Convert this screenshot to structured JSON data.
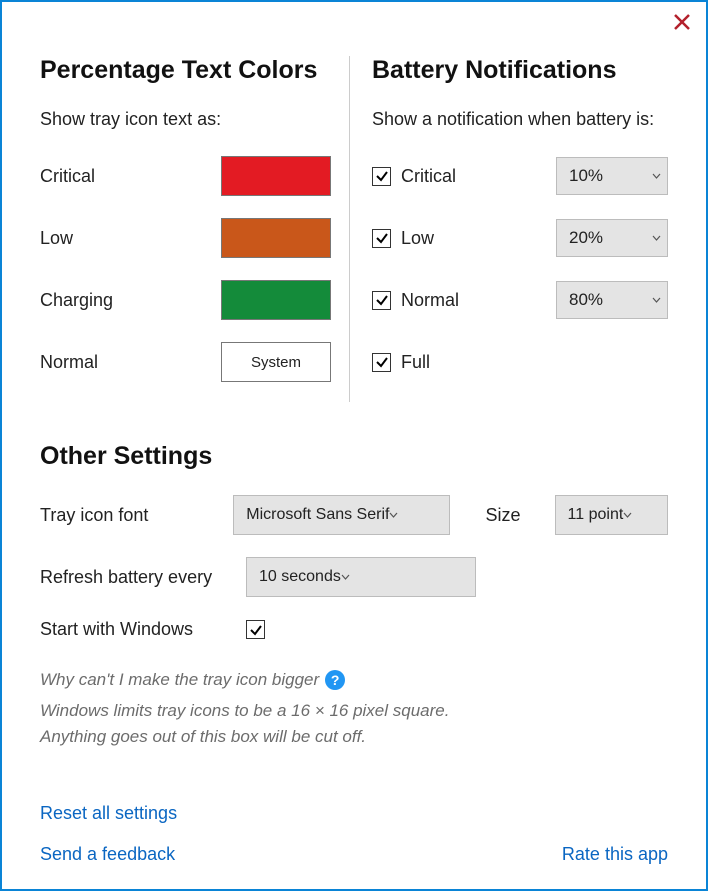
{
  "colors_section": {
    "title": "Percentage Text Colors",
    "subtitle": "Show tray icon text as:",
    "rows": {
      "critical": {
        "label": "Critical",
        "color": "#e31b23"
      },
      "low": {
        "label": "Low",
        "color": "#c9571a"
      },
      "charging": {
        "label": "Charging",
        "color": "#148b3a"
      },
      "normal": {
        "label": "Normal",
        "button_text": "System"
      }
    }
  },
  "notifications_section": {
    "title": "Battery Notifications",
    "subtitle": "Show a notification when battery is:",
    "critical": {
      "label": "Critical",
      "checked": true,
      "value": "10%"
    },
    "low": {
      "label": "Low",
      "checked": true,
      "value": "20%"
    },
    "normal": {
      "label": "Normal",
      "checked": true,
      "value": "80%"
    },
    "full": {
      "label": "Full",
      "checked": true
    }
  },
  "other_section": {
    "title": "Other Settings",
    "font_label": "Tray icon font",
    "font_value": "Microsoft Sans Serif",
    "size_label": "Size",
    "size_value": "11 point",
    "refresh_label": "Refresh battery every",
    "refresh_value": "10 seconds",
    "startup_label": "Start with Windows",
    "startup_checked": true
  },
  "faq": {
    "question": "Why can't I make the tray icon bigger",
    "answer_line1": "Windows limits tray icons to be a 16 × 16 pixel square.",
    "answer_line2": "Anything goes out of this box will be cut off."
  },
  "links": {
    "reset": "Reset all settings",
    "feedback": "Send a feedback",
    "rate": "Rate this app"
  }
}
